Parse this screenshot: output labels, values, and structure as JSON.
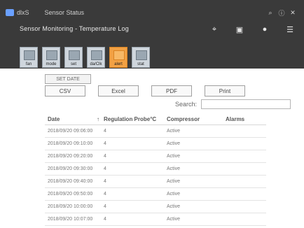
{
  "header": {
    "brand": "dlxS",
    "window_title": "Sensor Status",
    "subtitle": "Sensor Monitoring - Temperature Log",
    "controls": [
      "wifi-icon",
      "device-icon",
      "user-icon",
      "menu-icon"
    ]
  },
  "tiles": [
    {
      "id": "tile-1",
      "label": "fan"
    },
    {
      "id": "tile-2",
      "label": "mode"
    },
    {
      "id": "tile-3",
      "label": "set"
    },
    {
      "id": "tile-4",
      "label": "da/Clk"
    },
    {
      "id": "tile-5",
      "label": "alert",
      "active": true
    },
    {
      "id": "tile-6",
      "label": "stat"
    }
  ],
  "filters": {
    "set_date_label": "SET DATE"
  },
  "exports": [
    "CSV",
    "Excel",
    "PDF",
    "Print"
  ],
  "search": {
    "label": "Search:",
    "placeholder": ""
  },
  "table": {
    "columns": [
      "Date",
      "Regulation Probe°C",
      "Compressor",
      "Alarms"
    ],
    "rows": [
      [
        "2018/09/20 09:06:00",
        "4",
        "Active",
        ""
      ],
      [
        "2018/09/20 09:10:00",
        "4",
        "Active",
        ""
      ],
      [
        "2018/09/20 09:20:00",
        "4",
        "Active",
        ""
      ],
      [
        "2018/09/20 09:30:00",
        "4",
        "Active",
        ""
      ],
      [
        "2018/09/20 09:40:00",
        "4",
        "Active",
        ""
      ],
      [
        "2018/09/20 09:50:00",
        "4",
        "Active",
        ""
      ],
      [
        "2018/09/20 10:00:00",
        "4",
        "Active",
        ""
      ],
      [
        "2018/09/20 10:07:00",
        "4",
        "Active",
        ""
      ]
    ]
  }
}
